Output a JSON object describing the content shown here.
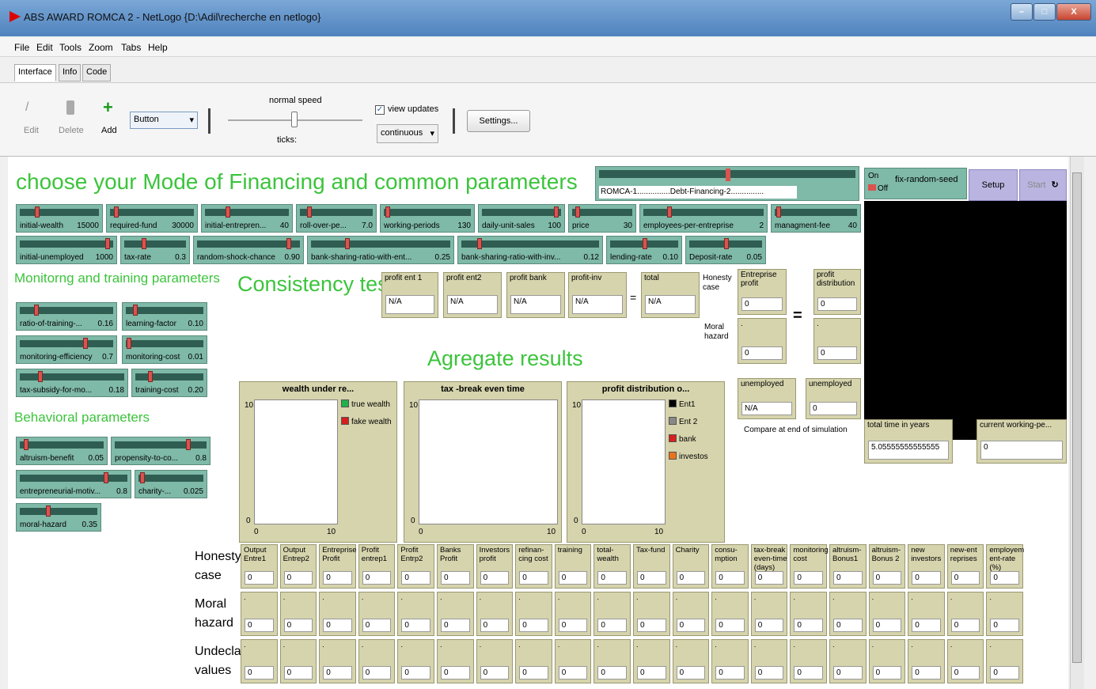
{
  "window": {
    "title": "ABS AWARD ROMCA 2 - NetLogo {D:\\Adil\\recherche en netlogo}",
    "min": "–",
    "max": "□",
    "close": "X"
  },
  "menu": [
    "File",
    "Edit",
    "Tools",
    "Zoom",
    "Tabs",
    "Help"
  ],
  "tabs": [
    "Interface",
    "Info",
    "Code"
  ],
  "toolbar": {
    "edit": "Edit",
    "delete": "Delete",
    "add": "Add",
    "widget_select": "Button",
    "speed_label": "normal speed",
    "ticks_label": "ticks:",
    "view_updates": "view updates",
    "update_mode": "continuous",
    "settings": "Settings..."
  },
  "headings": {
    "mode": "choose your Mode of Financing and common parameters",
    "monitoring": "Monitorng and training parameters",
    "behavioral": "Behavioral parameters",
    "consistency": "Consistency test",
    "aggregate": "Agregate  results"
  },
  "chooser": {
    "label": "ROMCA-1...............Debt-Financing-2..............."
  },
  "switch": {
    "on": "On",
    "off": "Off",
    "label": "fix-random-seed"
  },
  "buttons": {
    "setup": "Setup",
    "start": "Start"
  },
  "sliders": [
    {
      "label": "initial-wealth",
      "value": "15000",
      "pos": 0.2
    },
    {
      "label": "required-fund",
      "value": "30000",
      "pos": 0.05
    },
    {
      "label": "initial-entrepren...",
      "value": "40",
      "pos": 0.25
    },
    {
      "label": "roll-over-pe...",
      "value": "7.0",
      "pos": 0.1
    },
    {
      "label": "working-periods",
      "value": "130",
      "pos": 0.02
    },
    {
      "label": "daily-unit-sales",
      "value": "100",
      "pos": 0.95
    },
    {
      "label": "price",
      "value": "30",
      "pos": 0.05
    },
    {
      "label": "employees-per-entreprise",
      "value": "2",
      "pos": 0.2
    },
    {
      "label": "managment-fee",
      "value": "40",
      "pos": 0.02
    },
    {
      "label": "initial-unemployed",
      "value": "1000",
      "pos": 0.95
    },
    {
      "label": "tax-rate",
      "value": "0.3",
      "pos": 0.3
    },
    {
      "label": "random-shock-chance",
      "value": "0.90",
      "pos": 0.9
    },
    {
      "label": "bank-sharing-ratio-with-ent...",
      "value": "0.25",
      "pos": 0.25
    },
    {
      "label": "bank-sharing-ratio-with-inv...",
      "value": "0.12",
      "pos": 0.12
    },
    {
      "label": "lending-rate",
      "value": "0.10",
      "pos": 0.5
    },
    {
      "label": "Deposit-rate",
      "value": "0.05",
      "pos": 0.5
    },
    {
      "label": "ratio-of-training-...",
      "value": "0.16",
      "pos": 0.16
    },
    {
      "label": "learning-factor",
      "value": "0.10",
      "pos": 0.1
    },
    {
      "label": "monitoring-efficiency",
      "value": "0.7",
      "pos": 0.7
    },
    {
      "label": "monitoring-cost",
      "value": "0.01",
      "pos": 0.01
    },
    {
      "label": "tax-subsidy-for-mo...",
      "value": "0.18",
      "pos": 0.18
    },
    {
      "label": "training-cost",
      "value": "0.20",
      "pos": 0.2
    },
    {
      "label": "altruism-benefit",
      "value": "0.05",
      "pos": 0.05
    },
    {
      "label": "propensity-to-co...",
      "value": "0.8",
      "pos": 0.8
    },
    {
      "label": "entrepreneurial-motiv...",
      "value": "0.8",
      "pos": 0.8
    },
    {
      "label": "charity-...",
      "value": "0.025",
      "pos": 0.025
    },
    {
      "label": "moral-hazard",
      "value": "0.35",
      "pos": 0.35
    }
  ],
  "consistency": [
    {
      "label": "profit ent 1",
      "value": "N/A"
    },
    {
      "label": "profit ent2",
      "value": "N/A"
    },
    {
      "label": "profit bank",
      "value": "N/A"
    },
    {
      "label": "profit-inv",
      "value": "N/A"
    },
    {
      "label": "total",
      "value": "N/A"
    }
  ],
  "equals": "=",
  "honesty_case": "Honesty case",
  "moral_hazard": "Moral hazard",
  "ent_profit": {
    "label": "Entreprise profit",
    "value": "0"
  },
  "ent_moral": {
    "label": ".",
    "value": "0"
  },
  "profit_dist": {
    "label": "profit distribution",
    "value": "0"
  },
  "profit_dist_moral": {
    "label": ".",
    "value": "0"
  },
  "unemployed1": {
    "label": "unemployed",
    "value": "N/A"
  },
  "unemployed2": {
    "label": "unemployed",
    "value": "0"
  },
  "compare_note": "Compare at end of simulation",
  "total_time": {
    "label": "total time in years",
    "value": "5.05555555555555"
  },
  "current_working": {
    "label": "current working-pe...",
    "value": "0"
  },
  "plots": [
    {
      "title": "wealth under re...",
      "ymax": "10",
      "ymin": "0",
      "xmin": "0",
      "xmax": "10",
      "legend": [
        {
          "name": "true wealth",
          "color": "#22b14c"
        },
        {
          "name": "fake wealth",
          "color": "#d42020"
        }
      ]
    },
    {
      "title": "tax -break even time",
      "ymax": "10",
      "ymin": "0",
      "xmin": "0",
      "xmax": "10",
      "legend": []
    },
    {
      "title": "profit distribution o...",
      "ymax": "10",
      "ymin": "0",
      "xmin": "0",
      "xmax": "10",
      "legend": [
        {
          "name": "Ent1",
          "color": "#000000"
        },
        {
          "name": "Ent 2",
          "color": "#888888"
        },
        {
          "name": "bank",
          "color": "#d42020"
        },
        {
          "name": "investos",
          "color": "#e8741c"
        }
      ]
    }
  ],
  "grid_rows": {
    "honesty": "Honesty case",
    "moral": "Moral hazard",
    "undeclared": "Undeclared values"
  },
  "grid_cols": [
    "Output Entre1",
    "Output Entrep2",
    "Entreprise Profit",
    "Profit entrep1",
    "Profit Entrp2",
    "Banks Profit",
    "Investors profit",
    "refinan- cing cost",
    "training",
    "total- wealth",
    "Tax-fund",
    "Charity",
    "consu- mption",
    "tax-break even-time (days)",
    "monitoring cost",
    "altruism- Bonus1",
    "altruism- Bonus 2",
    "new investors",
    "new-ent reprises",
    "employem ent-rate (%)"
  ],
  "grid_value": "0",
  "grid_dot": "."
}
